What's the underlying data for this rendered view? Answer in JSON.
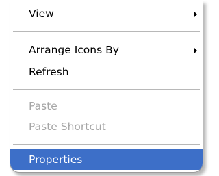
{
  "context_menu": {
    "items": [
      {
        "label": "View",
        "has_submenu": true,
        "enabled": true
      },
      {
        "label": "Arrange Icons By",
        "has_submenu": true,
        "enabled": true
      },
      {
        "label": "Refresh",
        "has_submenu": false,
        "enabled": true
      },
      {
        "label": "Paste",
        "has_submenu": false,
        "enabled": false
      },
      {
        "label": "Paste Shortcut",
        "has_submenu": false,
        "enabled": false
      },
      {
        "label": "Properties",
        "has_submenu": false,
        "enabled": true,
        "highlighted": true
      }
    ],
    "colors": {
      "highlight": "#3d6fc8",
      "disabled_text": "#a6a6a6",
      "separator": "#b8b8b8"
    }
  }
}
